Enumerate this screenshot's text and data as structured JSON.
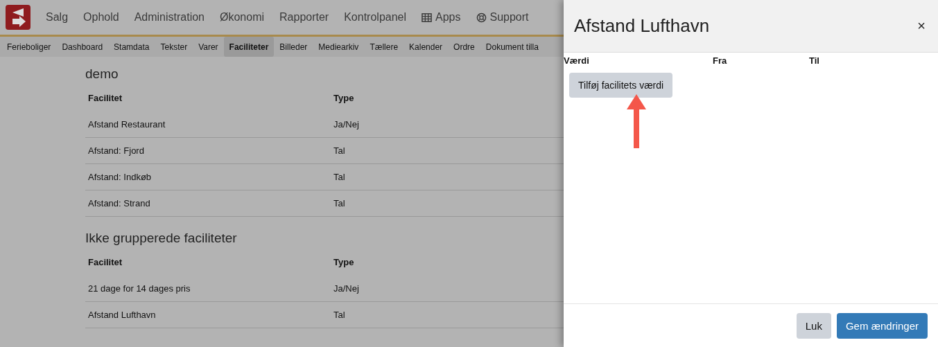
{
  "top_nav": [
    {
      "label": "Salg",
      "kind": "text"
    },
    {
      "label": "Ophold",
      "kind": "text"
    },
    {
      "label": "Administration",
      "kind": "text"
    },
    {
      "label": "Økonomi",
      "kind": "text"
    },
    {
      "label": "Rapporter",
      "kind": "text"
    },
    {
      "label": "Kontrolpanel",
      "kind": "text"
    },
    {
      "label": "Apps",
      "kind": "apps"
    },
    {
      "label": "Support",
      "kind": "support"
    }
  ],
  "sub_nav": [
    {
      "label": "Ferieboliger",
      "selected": false
    },
    {
      "label": "Dashboard",
      "selected": false
    },
    {
      "label": "Stamdata",
      "selected": false
    },
    {
      "label": "Tekster",
      "selected": false
    },
    {
      "label": "Varer",
      "selected": false
    },
    {
      "label": "Faciliteter",
      "selected": true
    },
    {
      "label": "Billeder",
      "selected": false
    },
    {
      "label": "Mediearkiv",
      "selected": false
    },
    {
      "label": "Tællere",
      "selected": false
    },
    {
      "label": "Kalender",
      "selected": false
    },
    {
      "label": "Ordre",
      "selected": false
    },
    {
      "label": "Dokument tilla",
      "selected": false
    }
  ],
  "groups": [
    {
      "title": "demo",
      "columns": [
        "Facilitet",
        "Type"
      ],
      "rows": [
        [
          "Afstand Restaurant",
          "Ja/Nej"
        ],
        [
          "Afstand: Fjord",
          "Tal"
        ],
        [
          "Afstand: Indkøb",
          "Tal"
        ],
        [
          "Afstand: Strand",
          "Tal"
        ]
      ]
    },
    {
      "title": "Ikke grupperede faciliteter",
      "columns": [
        "Facilitet",
        "Type"
      ],
      "rows": [
        [
          "21 dage for 14 dages pris",
          "Ja/Nej"
        ],
        [
          "Afstand Lufthavn",
          "Tal"
        ]
      ]
    }
  ],
  "drawer": {
    "title": "Afstand Lufthavn",
    "close": "×",
    "columns": [
      "Værdi",
      "Fra",
      "Til"
    ],
    "add_button": "Tilføj facilitets værdi",
    "buttons": [
      {
        "label": "Luk",
        "kind": "secondary"
      },
      {
        "label": "Gem ændringer",
        "kind": "primary"
      }
    ]
  }
}
